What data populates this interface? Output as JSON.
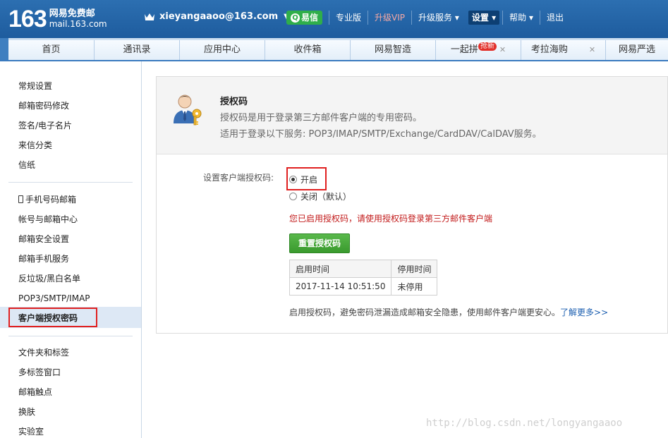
{
  "header": {
    "logo_num": "163",
    "logo_name": "网易免费邮",
    "logo_domain": "mail.163.com",
    "user_email": "xieyangaaoo@163.com",
    "nav": {
      "yixin": "易信",
      "pro": "专业版",
      "vip": "升级VIP",
      "upgrade": "升级服务",
      "settings": "设置",
      "help": "帮助",
      "logout": "退出"
    }
  },
  "tabs": [
    {
      "label": "首页"
    },
    {
      "label": "通讯录"
    },
    {
      "label": "应用中心"
    },
    {
      "label": "收件箱"
    },
    {
      "label": "网易智造"
    },
    {
      "label": "一起拼",
      "badge": "抢新",
      "closable": true
    },
    {
      "label": "考拉海购",
      "closable": true
    },
    {
      "label": "网易严选"
    }
  ],
  "sidebar": {
    "group1": [
      "常规设置",
      "邮箱密码修改",
      "签名/电子名片",
      "来信分类",
      "信纸"
    ],
    "group2": [
      "手机号码邮箱",
      "帐号与邮箱中心",
      "邮箱安全设置",
      "邮箱手机服务",
      "反垃圾/黑白名单",
      "POP3/SMTP/IMAP",
      "客户端授权密码"
    ],
    "group3": [
      "文件夹和标签",
      "多标签窗口",
      "邮箱触点",
      "换肤",
      "实验室"
    ],
    "active": "客户端授权密码"
  },
  "main": {
    "title": "授权码",
    "desc1": "授权码是用于登录第三方邮件客户端的专用密码。",
    "desc2": "适用于登录以下服务: POP3/IMAP/SMTP/Exchange/CardDAV/CalDAV服务。",
    "setting_label": "设置客户端授权码:",
    "option_on": "开启",
    "option_off": "关闭（默认）",
    "selected": "开启",
    "status_msg": "您已启用授权码，请使用授权码登录第三方邮件客户端",
    "reset_button": "重置授权码",
    "table": {
      "headers": [
        "启用时间",
        "停用时间"
      ],
      "row": [
        "2017-11-14 10:51:50",
        "未停用"
      ]
    },
    "tip": "启用授权码，避免密码泄漏造成邮箱安全隐患，使用邮件客户端更安心。",
    "learn_more": "了解更多>>"
  },
  "watermark": "http://blog.csdn.net/longyangaaoo",
  "colors": {
    "header_blue": "#1e5c9e",
    "accent_green": "#3a9a2e",
    "alert_red": "#c21a1a",
    "highlight_red": "#e02020"
  }
}
